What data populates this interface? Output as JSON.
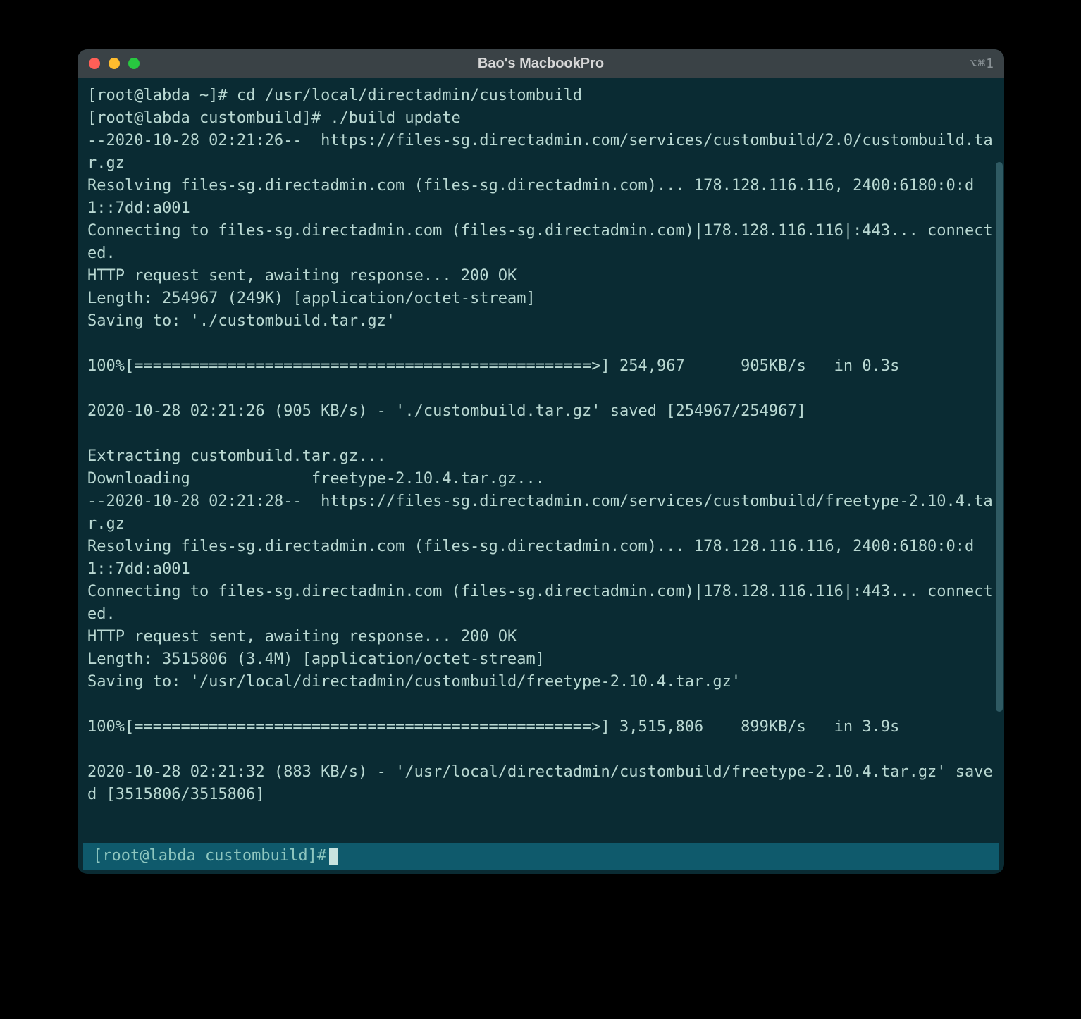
{
  "window": {
    "title": "Bao's MacbookPro",
    "shortcut_hint": "⌥⌘1"
  },
  "terminal": {
    "lines": [
      "[root@labda ~]# cd /usr/local/directadmin/custombuild",
      "[root@labda custombuild]# ./build update",
      "--2020-10-28 02:21:26--  https://files-sg.directadmin.com/services/custombuild/2.0/custombuild.tar.gz",
      "Resolving files-sg.directadmin.com (files-sg.directadmin.com)... 178.128.116.116, 2400:6180:0:d1::7dd:a001",
      "Connecting to files-sg.directadmin.com (files-sg.directadmin.com)|178.128.116.116|:443... connected.",
      "HTTP request sent, awaiting response... 200 OK",
      "Length: 254967 (249K) [application/octet-stream]",
      "Saving to: './custombuild.tar.gz'",
      "",
      "100%[=================================================>] 254,967      905KB/s   in 0.3s",
      "",
      "2020-10-28 02:21:26 (905 KB/s) - './custombuild.tar.gz' saved [254967/254967]",
      "",
      "Extracting custombuild.tar.gz...",
      "Downloading             freetype-2.10.4.tar.gz...",
      "--2020-10-28 02:21:28--  https://files-sg.directadmin.com/services/custombuild/freetype-2.10.4.tar.gz",
      "Resolving files-sg.directadmin.com (files-sg.directadmin.com)... 178.128.116.116, 2400:6180:0:d1::7dd:a001",
      "Connecting to files-sg.directadmin.com (files-sg.directadmin.com)|178.128.116.116|:443... connected.",
      "HTTP request sent, awaiting response... 200 OK",
      "Length: 3515806 (3.4M) [application/octet-stream]",
      "Saving to: '/usr/local/directadmin/custombuild/freetype-2.10.4.tar.gz'",
      "",
      "100%[=================================================>] 3,515,806    899KB/s   in 3.9s",
      "",
      "2020-10-28 02:21:32 (883 KB/s) - '/usr/local/directadmin/custombuild/freetype-2.10.4.tar.gz' saved [3515806/3515806]",
      ""
    ],
    "prompt": "[root@labda custombuild]#"
  }
}
